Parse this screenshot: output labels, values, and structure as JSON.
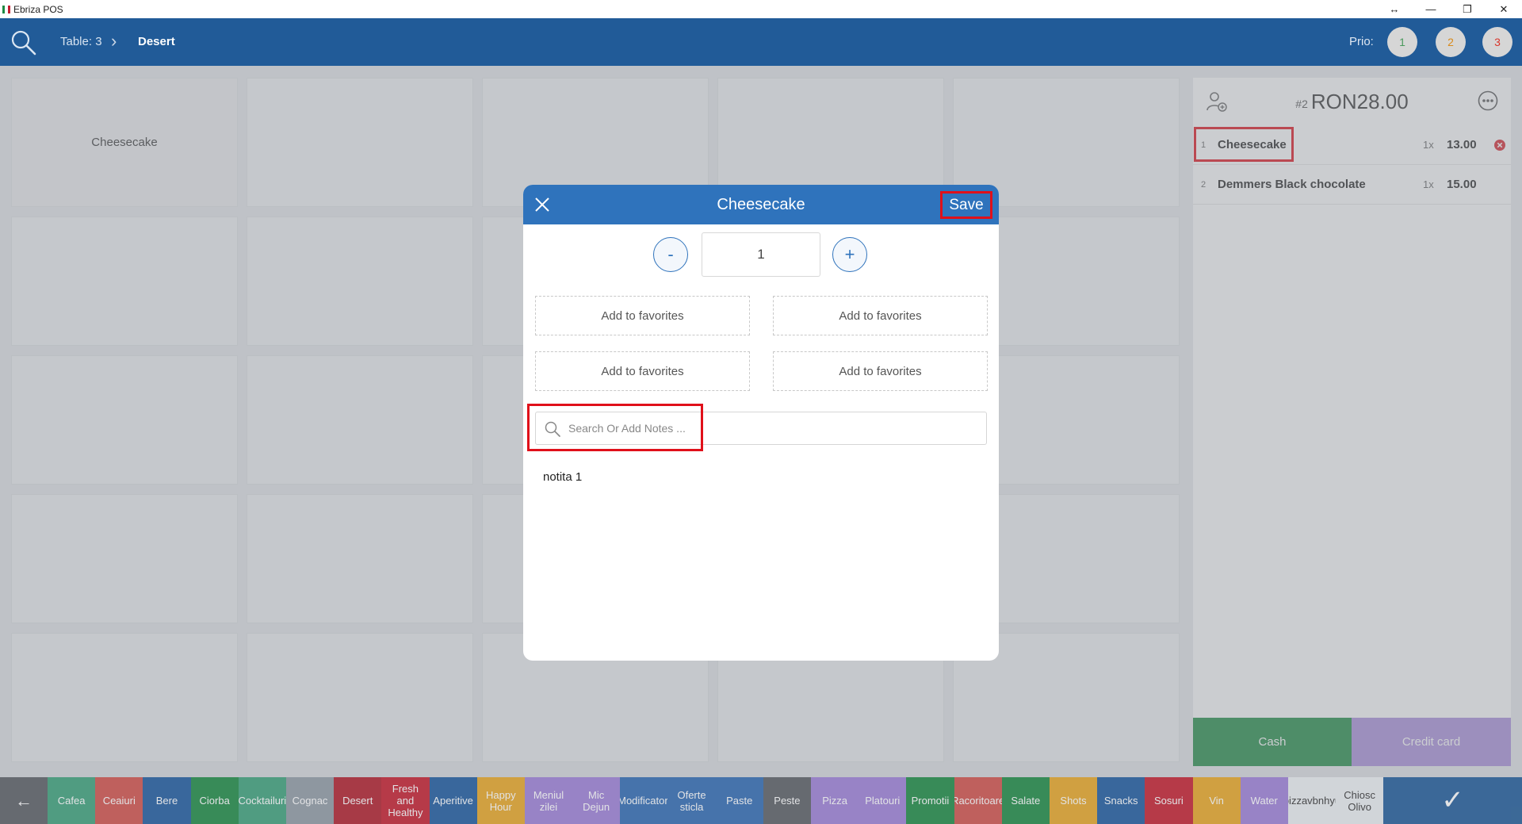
{
  "window": {
    "title": "Ebriza POS",
    "controls": [
      "↔",
      "—",
      "❐",
      "✕"
    ]
  },
  "header": {
    "table": "Table: 3",
    "separator": "›",
    "category": "Desert",
    "prio_label": "Prio:",
    "prio_levels": [
      {
        "label": "1",
        "color": "#4a9a5c"
      },
      {
        "label": "2",
        "color": "#d98a1a"
      },
      {
        "label": "3",
        "color": "#d9362b"
      }
    ]
  },
  "grid": {
    "tiles": [
      "Cheesecake"
    ]
  },
  "order": {
    "number": "#2",
    "total": "RON28.00",
    "lines": [
      {
        "index": "1",
        "name": "Cheesecake",
        "qty": "1x",
        "price": "13.00"
      },
      {
        "index": "2",
        "name": "Demmers Black chocolate",
        "qty": "1x",
        "price": "15.00"
      }
    ],
    "pay_cash": "Cash",
    "pay_card": "Credit card"
  },
  "categories": [
    {
      "label": "Cafea",
      "color": "#3da17a"
    },
    {
      "label": "Ceaiuri",
      "color": "#d0514a"
    },
    {
      "label": "Bere",
      "color": "#1e5a9e"
    },
    {
      "label": "Ciorba",
      "color": "#1d8a43"
    },
    {
      "label": "Cocktailuri",
      "color": "#3da17a"
    },
    {
      "label": "Cognac",
      "color": "#8f9aa3"
    },
    {
      "label": "Desert",
      "color": "#b01e2b"
    },
    {
      "label": "Fresh and Healthy",
      "color": "#c41e2e"
    },
    {
      "label": "Aperitive",
      "color": "#1e5a9e"
    },
    {
      "label": "Happy Hour",
      "color": "#e7a624"
    },
    {
      "label": "Meniul zilei",
      "color": "#9d7fd6"
    },
    {
      "label": "Mic Dejun",
      "color": "#9d7fd6"
    },
    {
      "label": "Modificatori",
      "color": "#2f6ab2"
    },
    {
      "label": "Oferte sticla",
      "color": "#2f6ab2"
    },
    {
      "label": "Paste",
      "color": "#2f6ab2"
    },
    {
      "label": "Peste",
      "color": "#5a5e63"
    },
    {
      "label": "Pizza",
      "color": "#9d7fd6"
    },
    {
      "label": "Platouri",
      "color": "#9d7fd6"
    },
    {
      "label": "Promotii",
      "color": "#1d8a43"
    },
    {
      "label": "Racoritoare",
      "color": "#d0514a"
    },
    {
      "label": "Salate",
      "color": "#1d8a43"
    },
    {
      "label": "Shots",
      "color": "#e7a624"
    },
    {
      "label": "Snacks",
      "color": "#1e5a9e"
    },
    {
      "label": "Sosuri",
      "color": "#c41e2e"
    },
    {
      "label": "Vin",
      "color": "#e7a624"
    },
    {
      "label": "Water",
      "color": "#9d7fd6"
    },
    {
      "label": "pizzavbnhyu",
      "color": "#e9ecef"
    },
    {
      "label": "Chiosc Olivo",
      "color": "#e9ecef"
    }
  ],
  "back_label": "←",
  "confirm_label": "✓",
  "modal": {
    "title": "Cheesecake",
    "save": "Save",
    "minus": "-",
    "plus": "+",
    "quantity": "1",
    "favorites": [
      "Add to favorites",
      "Add to favorites",
      "Add to favorites",
      "Add to favorites"
    ],
    "notes_placeholder": "Search Or Add Notes ...",
    "notes": [
      "notita 1"
    ]
  }
}
